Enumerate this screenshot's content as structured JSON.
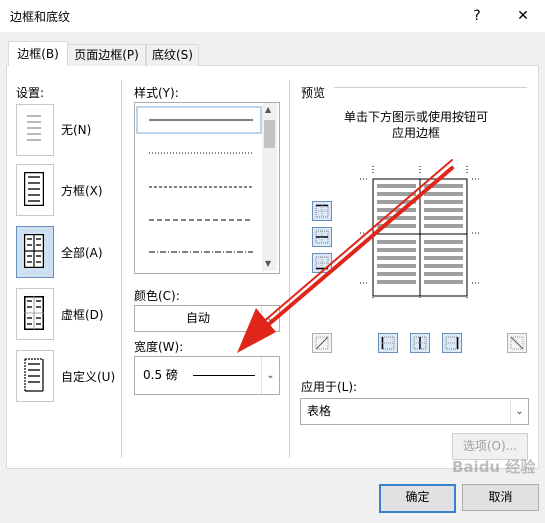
{
  "window": {
    "title": "边框和底纹",
    "help_label": "?",
    "close_label": "✕"
  },
  "tabs": [
    {
      "label": "边框(B)"
    },
    {
      "label": "页面边框(P)"
    },
    {
      "label": "底纹(S)"
    }
  ],
  "settings": {
    "heading": "设置:",
    "items": [
      {
        "label": "无(N)",
        "icon": "border-none-icon"
      },
      {
        "label": "方框(X)",
        "icon": "border-box-icon"
      },
      {
        "label": "全部(A)",
        "icon": "border-all-icon"
      },
      {
        "label": "虚框(D)",
        "icon": "border-grid-icon"
      },
      {
        "label": "自定义(U)",
        "icon": "border-custom-icon"
      }
    ],
    "selected": "全部(A)"
  },
  "style": {
    "heading": "样式(Y):",
    "options": [
      "solid",
      "dotted",
      "dashed-fine",
      "dashed",
      "dash-dot"
    ]
  },
  "color": {
    "heading": "颜色(C):",
    "value": "自动"
  },
  "width": {
    "heading": "宽度(W):",
    "value": "0.5 磅"
  },
  "preview": {
    "heading": "预览",
    "hint_line1": "单击下方图示或使用按钮可",
    "hint_line2": "应用边框"
  },
  "apply_to": {
    "heading": "应用于(L):",
    "value": "表格"
  },
  "options_button": "选项(O)...",
  "ok_button": "确定",
  "cancel_button": "取消",
  "watermark": "Baidu 经验",
  "colors": {
    "accent": "#3c7fd0",
    "selected_bg": "#cfe0f3",
    "arrow": "#e0261b"
  }
}
